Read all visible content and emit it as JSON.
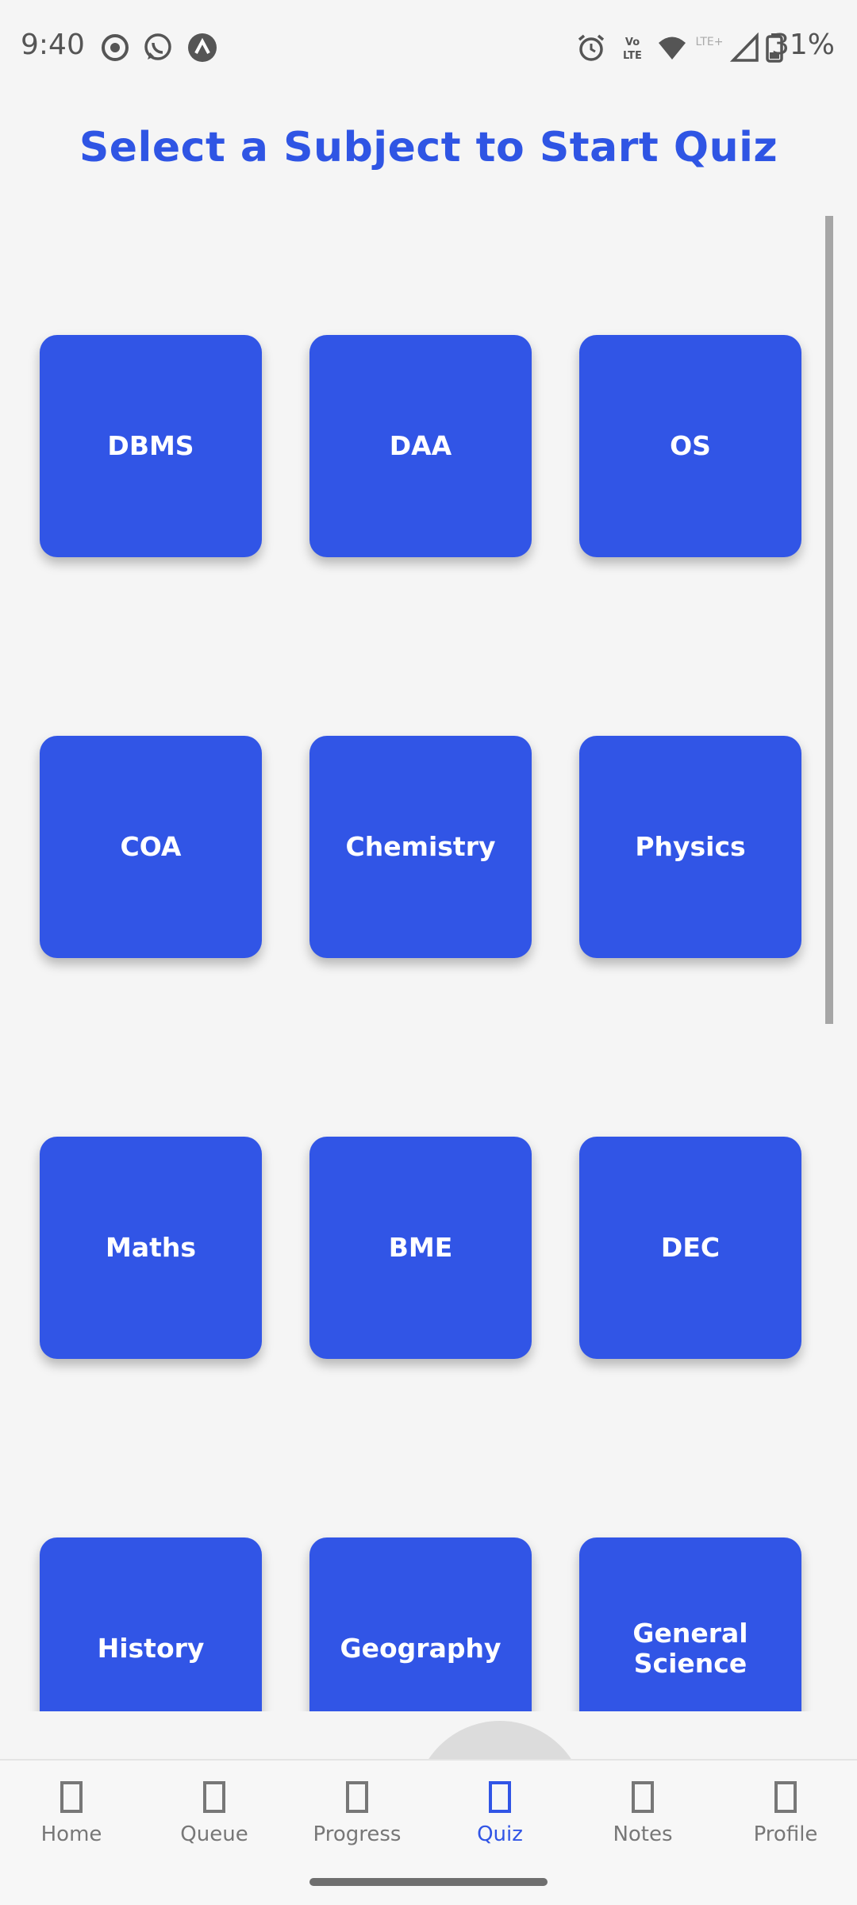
{
  "status_bar": {
    "time": "9:40",
    "battery": "31%",
    "left_icons": [
      "screen-record-icon",
      "whatsapp-icon",
      "app-notification-icon"
    ],
    "right_icons": [
      "alarm-icon",
      "volte-icon",
      "wifi-icon",
      "lte-icon",
      "signal-icon",
      "battery-icon"
    ]
  },
  "page": {
    "title": "Select a Subject to Start Quiz"
  },
  "subjects": [
    [
      "DBMS",
      "DAA",
      "OS"
    ],
    [
      "COA",
      "Chemistry",
      "Physics"
    ],
    [
      "Maths",
      "BME",
      "DEC"
    ],
    [
      "History",
      "Geography",
      "General Science"
    ]
  ],
  "bottom_nav": {
    "items": [
      {
        "label": "Home"
      },
      {
        "label": "Queue"
      },
      {
        "label": "Progress"
      },
      {
        "label": "Quiz"
      },
      {
        "label": "Notes"
      },
      {
        "label": "Profile"
      }
    ],
    "active": "Quiz"
  },
  "colors": {
    "accent": "#3155e6",
    "title": "#2f55e4",
    "background": "#f5f5f5"
  }
}
